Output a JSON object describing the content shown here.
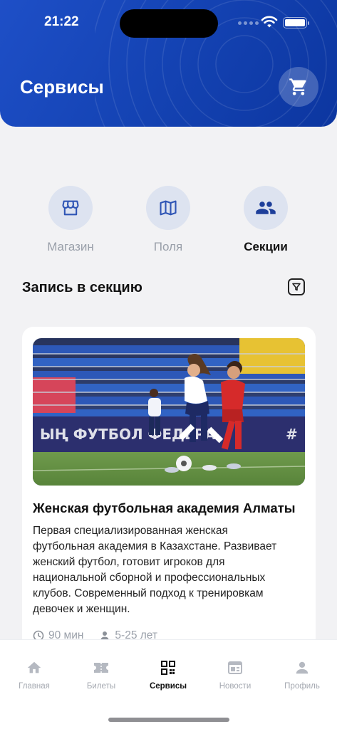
{
  "status_bar": {
    "time": "21:22"
  },
  "header": {
    "title": "Сервисы",
    "cart_icon": "cart-icon"
  },
  "categories": [
    {
      "label": "Магазин",
      "icon": "store-icon",
      "active": false
    },
    {
      "label": "Поля",
      "icon": "map-icon",
      "active": false
    },
    {
      "label": "Секции",
      "icon": "group-icon",
      "active": true
    }
  ],
  "section": {
    "title": "Запись в секцию",
    "filter_icon": "filter-icon"
  },
  "card": {
    "title": "Женская футбольная академия Алматы",
    "description": "Первая специализированная женская футбольная академия в Казахстане. Развивает женский футбол, готовит игроков для национальной сборной и профессиональных клубов. Современный подход к тренировкам девочек и женщин.",
    "duration": "90 мин",
    "age": "5-25 лет"
  },
  "tabbar": {
    "items": [
      {
        "label": "Главная",
        "icon": "home-icon",
        "active": false
      },
      {
        "label": "Билеты",
        "icon": "ticket-icon",
        "active": false
      },
      {
        "label": "Сервисы",
        "icon": "services-icon",
        "active": true
      },
      {
        "label": "Новости",
        "icon": "news-icon",
        "active": false
      },
      {
        "label": "Профиль",
        "icon": "profile-icon",
        "active": false
      }
    ]
  },
  "colors": {
    "brand": "#1544b5",
    "inactive": "#9aa0aa",
    "icon_bg": "#dde3f0",
    "icon_fg": "#2f55b5"
  }
}
